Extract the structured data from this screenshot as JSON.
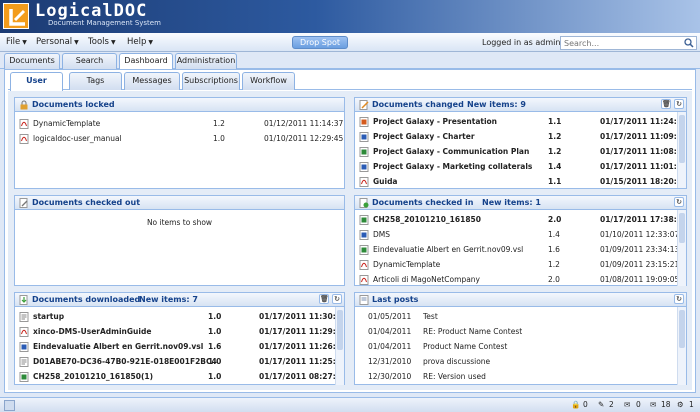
{
  "app": {
    "brand": "LogicalDOC",
    "tagline": "Document Management System"
  },
  "menu": [
    {
      "label": "File"
    },
    {
      "label": "Personal"
    },
    {
      "label": "Tools"
    },
    {
      "label": "Help"
    }
  ],
  "drop_spot": "Drop Spot",
  "logged_in": "Logged in as admin",
  "search": {
    "placeholder": "Search...",
    "value": ""
  },
  "main_tabs": [
    {
      "label": "Documents"
    },
    {
      "label": "Search"
    },
    {
      "label": "Dashboard"
    },
    {
      "label": "Administration"
    }
  ],
  "active_main_tab": "Dashboard",
  "sub_tabs": [
    {
      "label": "User"
    },
    {
      "label": "Tags"
    },
    {
      "label": "Messages"
    },
    {
      "label": "Subscriptions"
    },
    {
      "label": "Workflow"
    }
  ],
  "active_sub_tab": "User",
  "panels": {
    "locked": {
      "title": "Documents locked",
      "rows": [
        {
          "name": "DynamicTemplate",
          "version": "1.2",
          "date": "01/12/2011 11:14:37",
          "icon": "pdf-icon"
        },
        {
          "name": "logicaldoc-user_manual",
          "version": "1.0",
          "date": "01/10/2011 12:29:45",
          "icon": "pdf-icon"
        }
      ]
    },
    "changed": {
      "title": "Documents changed",
      "new_items": "New items: 9",
      "rows": [
        {
          "name": "Project Galaxy - Presentation",
          "version": "1.1",
          "date": "01/17/2011 11:24:40",
          "icon": "ppt-icon"
        },
        {
          "name": "Project Galaxy - Charter",
          "version": "1.2",
          "date": "01/17/2011 11:09:42",
          "icon": "doc-icon"
        },
        {
          "name": "Project Galaxy - Communication Plan",
          "version": "1.2",
          "date": "01/17/2011 11:08:58",
          "icon": "xls-icon"
        },
        {
          "name": "Project Galaxy - Marketing collaterals",
          "version": "1.4",
          "date": "01/17/2011 11:01:42",
          "icon": "doc-icon"
        },
        {
          "name": "Guida",
          "version": "1.1",
          "date": "01/15/2011 18:20:46",
          "icon": "pdf-icon"
        }
      ]
    },
    "checked_out": {
      "title": "Documents checked out",
      "empty_text": "No items to show"
    },
    "checked_in": {
      "title": "Documents checked in",
      "new_items": "New items: 1",
      "rows": [
        {
          "name": "CH258_20101210_161850",
          "version": "2.0",
          "date": "01/17/2011 17:38:17",
          "icon": "xls-icon",
          "bold": true
        },
        {
          "name": "DMS",
          "version": "1.4",
          "date": "01/10/2011 12:33:07",
          "icon": "doc-icon",
          "bold": false
        },
        {
          "name": "Eindevaluatie Albert en Gerrit.nov09.vsl",
          "version": "1.6",
          "date": "01/09/2011 23:34:13",
          "icon": "xls-icon",
          "bold": false
        },
        {
          "name": "DynamicTemplate",
          "version": "1.2",
          "date": "01/09/2011 23:15:21",
          "icon": "pdf-icon",
          "bold": false
        },
        {
          "name": "Articoli di MagoNetCompany",
          "version": "2.0",
          "date": "01/08/2011 19:09:05",
          "icon": "pdf-icon",
          "bold": false
        }
      ]
    },
    "downloaded": {
      "title": "Documents downloaded",
      "new_items": "New items: 7",
      "rows": [
        {
          "name": "startup",
          "version": "1.0",
          "date": "01/17/2011 11:30:24",
          "icon": "txt-icon"
        },
        {
          "name": "xinco-DMS-UserAdminGuide",
          "version": "1.0",
          "date": "01/17/2011 11:29:06",
          "icon": "pdf-icon"
        },
        {
          "name": "Eindevaluatie Albert en Gerrit.nov09.vsl",
          "version": "1.6",
          "date": "01/17/2011 11:26:57",
          "icon": "doc-icon"
        },
        {
          "name": "D01ABE70-DC36-47B0-921E-018E001F2BC4",
          "version": "1.0",
          "date": "01/17/2011 11:25:13",
          "icon": "txt-icon"
        },
        {
          "name": "CH258_20101210_161850(1)",
          "version": "1.0",
          "date": "01/17/2011 08:27:50",
          "icon": "xls-icon"
        }
      ]
    },
    "posts": {
      "title": "Last posts",
      "rows": [
        {
          "date": "01/05/2011",
          "subject": "Test"
        },
        {
          "date": "01/04/2011",
          "subject": "RE: Product Name Contest"
        },
        {
          "date": "01/04/2011",
          "subject": "Product Name Contest"
        },
        {
          "date": "12/31/2010",
          "subject": "prova discussione"
        },
        {
          "date": "12/30/2010",
          "subject": "RE: Version used"
        }
      ]
    }
  },
  "status_counts": [
    {
      "icon": "lock-icon",
      "count": "0"
    },
    {
      "icon": "checkout-icon",
      "count": "2"
    },
    {
      "icon": "message-icon",
      "count": "0"
    },
    {
      "icon": "email-icon",
      "count": "18"
    },
    {
      "icon": "workflow-icon",
      "count": "1"
    }
  ]
}
